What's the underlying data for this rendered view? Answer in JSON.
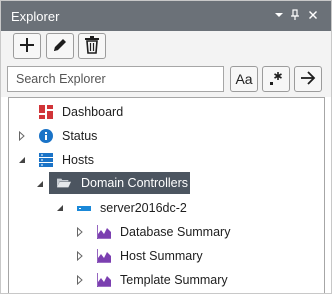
{
  "titlebar": {
    "title": "Explorer",
    "icons": [
      "chevron-down-icon",
      "pin-icon",
      "close-icon"
    ]
  },
  "toolbar": {
    "buttons": [
      "add-icon",
      "edit-icon",
      "delete-icon"
    ]
  },
  "search": {
    "placeholder": "Search Explorer",
    "value": "",
    "match_case_label": "Aa",
    "buttons": [
      "match-case-icon",
      "regex-icon",
      "go-arrow-icon"
    ]
  },
  "tree": {
    "items": [
      {
        "label": "Dashboard",
        "icon": "dashboard-icon",
        "expander": "none"
      },
      {
        "label": "Status",
        "icon": "info-icon",
        "expander": "collapsed"
      },
      {
        "label": "Hosts",
        "icon": "hosts-icon",
        "expander": "expanded"
      },
      {
        "label": "Domain Controllers",
        "icon": "folder-open-icon",
        "expander": "expanded",
        "selected": true
      },
      {
        "label": "server2016dc-2",
        "icon": "server-icon",
        "expander": "expanded"
      },
      {
        "label": "Database Summary",
        "icon": "chart-icon",
        "expander": "collapsed"
      },
      {
        "label": "Host Summary",
        "icon": "chart-icon",
        "expander": "collapsed"
      },
      {
        "label": "Template Summary",
        "icon": "chart-icon",
        "expander": "collapsed"
      }
    ]
  },
  "colors": {
    "titlebar": "#6b7178",
    "selection": "#4c5560",
    "dashboard_icon": "#d13438",
    "info_icon": "#1a73c7",
    "hosts_icon": "#1a73c7",
    "server_icon": "#1a88d8",
    "chart_icon": "#7b3fb0"
  }
}
